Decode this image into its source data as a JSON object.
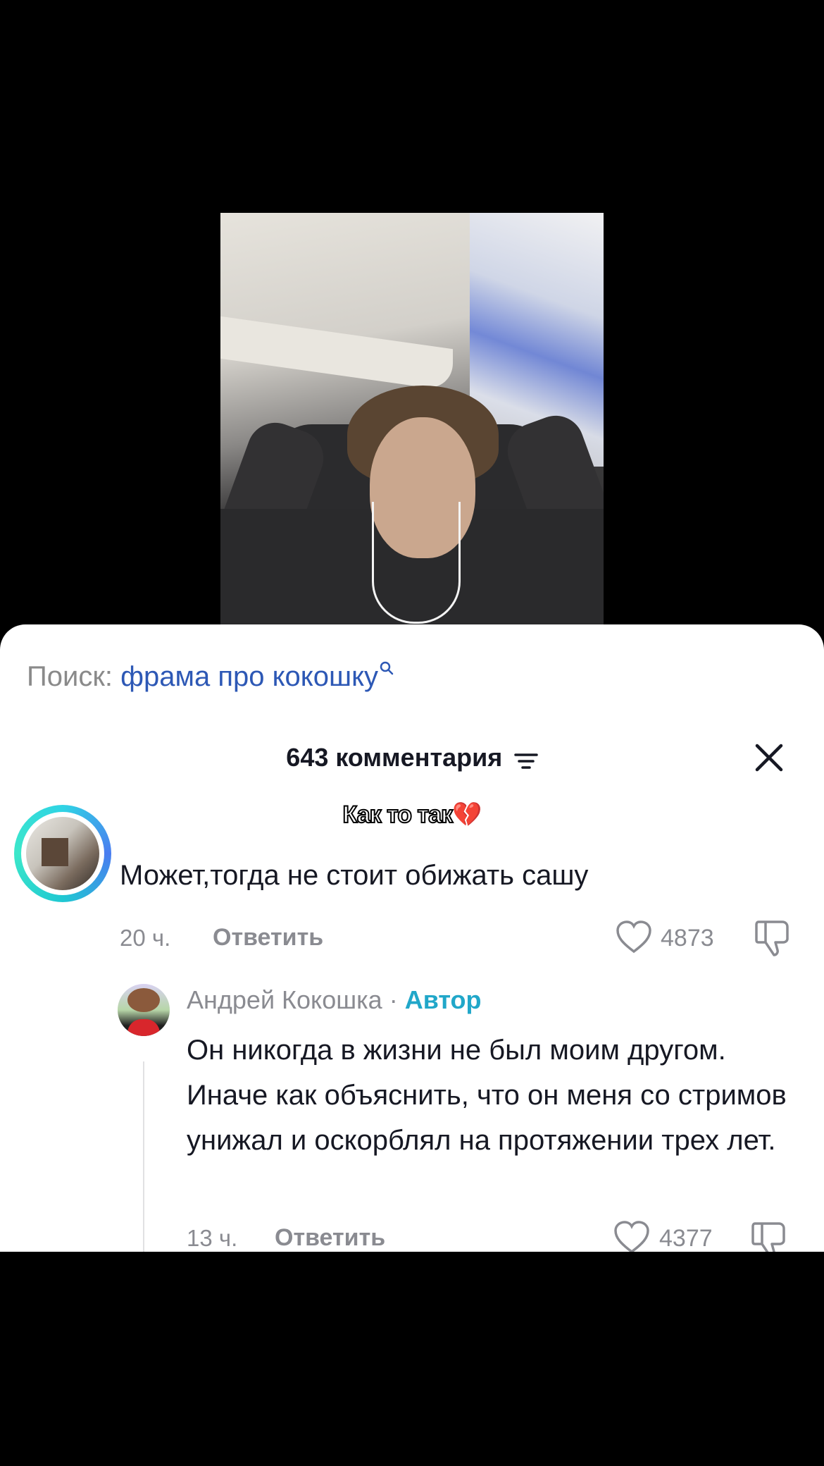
{
  "search": {
    "label": "Поиск:",
    "query": "фрама про кокошку",
    "icon": "search-icon"
  },
  "comments_header": {
    "count_label": "643 комментария",
    "sort_icon": "sort-lines-icon",
    "close_icon": "close-icon"
  },
  "sticker": {
    "text": "Как то так",
    "emoji": "💔"
  },
  "comment1": {
    "text": "Может,тогда не стоит обижать сашу",
    "time": "20 ч.",
    "reply_label": "Ответить",
    "likes": "4873"
  },
  "comment2": {
    "author": "Андрей Кокошка",
    "separator": "·",
    "badge": "Автор",
    "text": "Он никогда в жизни не был моим другом. Иначе как объяснить, что он меня со стримов унижал и оскорблял на протяжении трех лет.",
    "time": "13 ч.",
    "reply_label": "Ответить",
    "likes": "4377"
  },
  "colors": {
    "sheet_bg": "#ffffff",
    "primary_text": "#161823",
    "secondary_text": "#8a8b91",
    "search_query": "#2d58b5",
    "author_badge": "#21a7c9",
    "avatar_ring": "#2fd4e4"
  }
}
